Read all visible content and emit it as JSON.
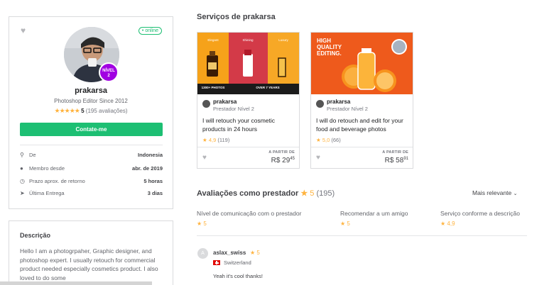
{
  "profile": {
    "online_label": "• online",
    "level_line1": "NÍVEL",
    "level_line2": "2",
    "username": "prakarsa",
    "tagline": "Photoshop Editor Since 2012",
    "stars": "★★★★★",
    "rating": "5",
    "rating_count": "(195 avaliações)",
    "contact_label": "Contate-me",
    "stats": [
      {
        "icon": "location-pin-icon",
        "label": "De",
        "value": "Indonesia"
      },
      {
        "icon": "person-icon",
        "label": "Membro desde",
        "value": "abr. de 2019"
      },
      {
        "icon": "clock-icon",
        "label": "Prazo aprox. de retorno",
        "value": "5 horas"
      },
      {
        "icon": "send-icon",
        "label": "Última Entrega",
        "value": "3 dias"
      }
    ]
  },
  "description": {
    "title": "Descrição",
    "text": "Hello I am a photogrpaher, Graphic designer, and photoshop expert. I usually retouch for commercial product needed especially cosmetics product. I also loved to do some"
  },
  "services": {
    "title": "Serviços de prakarsa",
    "gigs": [
      {
        "seller": "prakarsa",
        "level": "Prestador Nível 2",
        "title": "I will retouch your cosmetic products in 24 hours",
        "star": "★",
        "rating": "4,9",
        "count": "(119)",
        "from_label": "A PARTIR DE",
        "price_main": "R$ 29",
        "price_cents": "45",
        "img_labels": {
          "elegant": "Elegant",
          "shining": "Shining",
          "luxury": "Luxury",
          "photos": "1300+ PHOTOS",
          "years": "OVER 7 YEARS"
        }
      },
      {
        "seller": "prakarsa",
        "level": "Prestador Nível 2",
        "title": "I will do retouch and edit for your food and beverage photos",
        "star": "★",
        "rating": "5,0",
        "count": "(66)",
        "from_label": "A PARTIR DE",
        "price_main": "R$ 58",
        "price_cents": "91",
        "img_labels": {
          "headline1": "HIGH",
          "headline2": "QUALITY",
          "headline3": "EDITING."
        }
      }
    ]
  },
  "reviews": {
    "title": "Avaliações como prestador",
    "star": "★",
    "rating": "5",
    "count": "(195)",
    "sort_label": "Mais relevante",
    "criteria": [
      {
        "label": "Nível de comunicação com o prestador",
        "star": "★",
        "value": "5"
      },
      {
        "label": "Recomendar a um amigo",
        "star": "★",
        "value": "5"
      },
      {
        "label": "Serviço conforme a descrição",
        "star": "★",
        "value": "4,9"
      }
    ],
    "items": [
      {
        "avatar_letter": "A",
        "name": "aslax_swiss",
        "star": "★",
        "rating": "5",
        "country": "Switzerland",
        "text": "Yeah it's cool thanks!"
      }
    ]
  },
  "colors": {
    "brand_green": "#1dbf73",
    "star_yellow": "#ffb33e",
    "level_purple": "#a100e2"
  }
}
